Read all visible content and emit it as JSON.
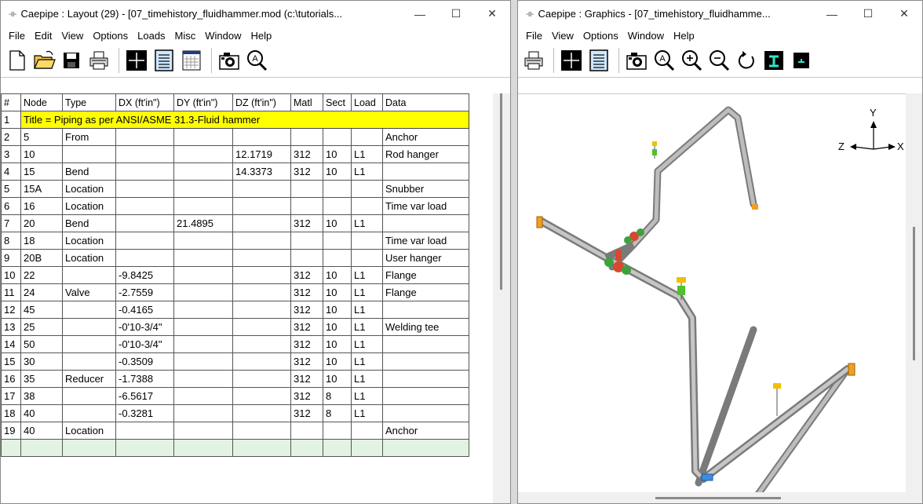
{
  "layout_window": {
    "title": "Caepipe : Layout (29) - [07_timehistory_fluidhammer.mod (c:\\tutorials...",
    "app_icon": "-ıı-",
    "menu": [
      "File",
      "Edit",
      "View",
      "Options",
      "Loads",
      "Misc",
      "Window",
      "Help"
    ],
    "toolbar_icons": [
      "new-file-icon",
      "open-folder-icon",
      "save-icon",
      "print-icon",
      "crosshair-icon",
      "list-view-icon",
      "table-view-icon",
      "camera-icon",
      "zoom-all-icon"
    ],
    "columns": [
      "#",
      "Node",
      "Type",
      "DX (ft'in\")",
      "DY (ft'in\")",
      "DZ (ft'in\")",
      "Matl",
      "Sect",
      "Load",
      "Data"
    ],
    "title_row": {
      "num": "1",
      "text": "Title = Piping as per ANSI/ASME 31.3-Fluid hammer"
    },
    "rows": [
      [
        "2",
        "5",
        "From",
        "",
        "",
        "",
        "",
        "",
        "",
        "Anchor"
      ],
      [
        "3",
        "10",
        "",
        "",
        "",
        "12.1719",
        "312",
        "10",
        "L1",
        "Rod hanger"
      ],
      [
        "4",
        "15",
        "Bend",
        "",
        "",
        "14.3373",
        "312",
        "10",
        "L1",
        ""
      ],
      [
        "5",
        "15A",
        "Location",
        "",
        "",
        "",
        "",
        "",
        "",
        "Snubber"
      ],
      [
        "6",
        "16",
        "Location",
        "",
        "",
        "",
        "",
        "",
        "",
        "Time var load"
      ],
      [
        "7",
        "20",
        "Bend",
        "",
        "21.4895",
        "",
        "312",
        "10",
        "L1",
        ""
      ],
      [
        "8",
        "18",
        "Location",
        "",
        "",
        "",
        "",
        "",
        "",
        "Time var load"
      ],
      [
        "9",
        "20B",
        "Location",
        "",
        "",
        "",
        "",
        "",
        "",
        "User hanger"
      ],
      [
        "10",
        "22",
        "",
        "-9.8425",
        "",
        "",
        "312",
        "10",
        "L1",
        "Flange"
      ],
      [
        "11",
        "24",
        "Valve",
        "-2.7559",
        "",
        "",
        "312",
        "10",
        "L1",
        "Flange"
      ],
      [
        "12",
        "45",
        "",
        "-0.4165",
        "",
        "",
        "312",
        "10",
        "L1",
        ""
      ],
      [
        "13",
        "25",
        "",
        "-0'10-3/4\"",
        "",
        "",
        "312",
        "10",
        "L1",
        "Welding tee"
      ],
      [
        "14",
        "50",
        "",
        "-0'10-3/4\"",
        "",
        "",
        "312",
        "10",
        "L1",
        ""
      ],
      [
        "15",
        "30",
        "",
        "-0.3509",
        "",
        "",
        "312",
        "10",
        "L1",
        ""
      ],
      [
        "16",
        "35",
        "Reducer",
        "-1.7388",
        "",
        "",
        "312",
        "10",
        "L1",
        ""
      ],
      [
        "17",
        "38",
        "",
        "-6.5617",
        "",
        "",
        "312",
        "8",
        "L1",
        ""
      ],
      [
        "18",
        "40",
        "",
        "-0.3281",
        "",
        "",
        "312",
        "8",
        "L1",
        ""
      ],
      [
        "19",
        "40",
        "Location",
        "",
        "",
        "",
        "",
        "",
        "",
        "Anchor"
      ]
    ]
  },
  "graphics_window": {
    "title": "Caepipe : Graphics - [07_timehistory_fluidhamme...",
    "app_icon": "-ıı-",
    "menu": [
      "File",
      "View",
      "Options",
      "Window",
      "Help"
    ],
    "toolbar_icons": [
      "print-icon",
      "crosshair-icon",
      "list-view-icon",
      "camera-icon",
      "zoom-all-icon",
      "zoom-in-icon",
      "zoom-out-icon",
      "rotate-icon",
      "render-icon",
      "small-render-icon"
    ],
    "axes": {
      "y": "Y",
      "z": "Z",
      "x": "X"
    }
  },
  "window_buttons": {
    "minimize": "—",
    "maximize": "☐",
    "close": "✕"
  }
}
